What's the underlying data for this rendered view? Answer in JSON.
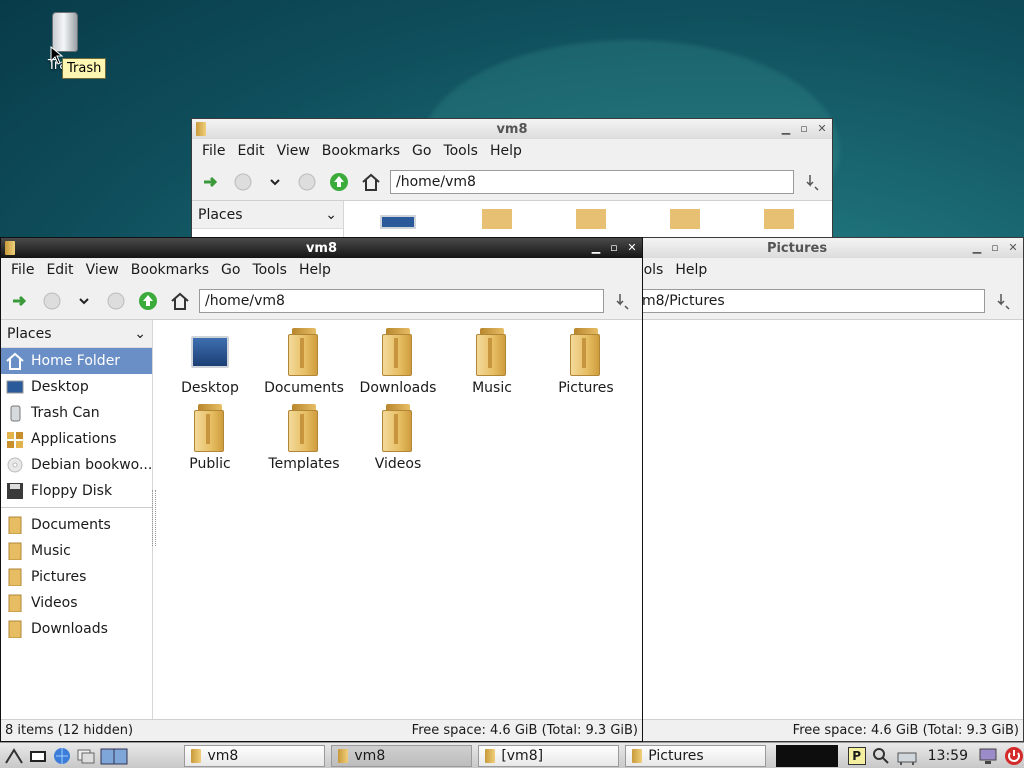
{
  "desktop": {
    "trash_label": "Trash",
    "tooltip": "Trash"
  },
  "win_back": {
    "title": "vm8",
    "menu": [
      "File",
      "Edit",
      "View",
      "Bookmarks",
      "Go",
      "Tools",
      "Help"
    ],
    "address": "/home/vm8",
    "places_label": "Places"
  },
  "win_pictures": {
    "title": "Pictures",
    "menu_visible": [
      "ools",
      "Help"
    ],
    "address": "m8/Pictures",
    "status_right": "Free space: 4.6 GiB (Total: 9.3 GiB)"
  },
  "win_front": {
    "title": "vm8",
    "menu": [
      "File",
      "Edit",
      "View",
      "Bookmarks",
      "Go",
      "Tools",
      "Help"
    ],
    "address": "/home/vm8",
    "places_label": "Places",
    "places": [
      {
        "label": "Home Folder",
        "icon": "home-icon",
        "selected": true
      },
      {
        "label": "Desktop",
        "icon": "desktop-icon"
      },
      {
        "label": "Trash Can",
        "icon": "trash-icon"
      },
      {
        "label": "Applications",
        "icon": "applications-icon"
      },
      {
        "label": "Debian bookwo...",
        "icon": "disc-icon"
      },
      {
        "label": "Floppy Disk",
        "icon": "floppy-icon"
      }
    ],
    "bookmarks": [
      "Documents",
      "Music",
      "Pictures",
      "Videos",
      "Downloads"
    ],
    "items": [
      {
        "label": "Desktop",
        "icon": "desktop-icon"
      },
      {
        "label": "Documents",
        "icon": "folder-icon"
      },
      {
        "label": "Downloads",
        "icon": "folder-icon"
      },
      {
        "label": "Music",
        "icon": "folder-icon"
      },
      {
        "label": "Pictures",
        "icon": "folder-icon"
      },
      {
        "label": "Public",
        "icon": "folder-icon"
      },
      {
        "label": "Templates",
        "icon": "folder-icon"
      },
      {
        "label": "Videos",
        "icon": "folder-icon"
      }
    ],
    "status_left": "8 items (12 hidden)",
    "status_right": "Free space: 4.6 GiB (Total: 9.3 GiB)"
  },
  "taskbar": {
    "tasks": [
      {
        "label": "vm8",
        "active": false
      },
      {
        "label": "vm8",
        "active": true
      },
      {
        "label": "[vm8]",
        "active": false
      },
      {
        "label": "Pictures",
        "active": false
      }
    ],
    "clock": "13:59",
    "tray_letter": "P"
  },
  "colors": {
    "selection": "#6a8fc7",
    "active_titlebar": "#1e1e1e",
    "desktop": "#1d6f78"
  }
}
